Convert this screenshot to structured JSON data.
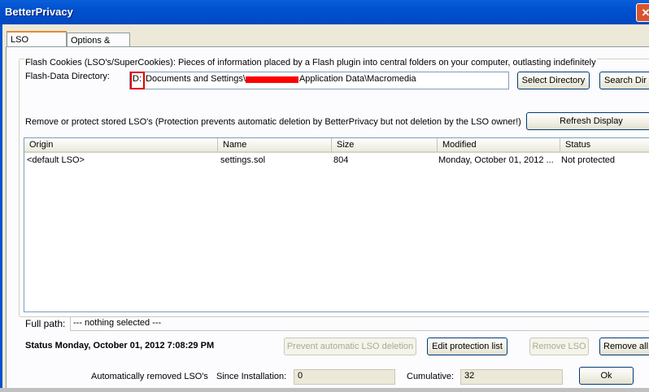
{
  "window": {
    "title": "BetterPrivacy",
    "close_glyph": "✕"
  },
  "tabs": [
    {
      "label": "LSO Manager"
    },
    {
      "label": "Options & Help"
    }
  ],
  "group": {
    "description": "Flash Cookies (LSO's/SuperCookies): Pieces of information placed by a Flash plugin into central folders on your computer, outlasting indefinitely",
    "directory_label": "Flash-Data Directory:",
    "directory_drive": "D:",
    "directory_path_prefix": "Documents and Settings\\",
    "directory_path_suffix": "Application Data\\Macromedia",
    "select_directory_button": "Select Directory",
    "search_button": "Search Dir"
  },
  "instruction": "Remove or protect stored LSO's (Protection prevents automatic deletion by BetterPrivacy but not deletion by the LSO owner!)",
  "refresh_button": "Refresh Display",
  "table": {
    "columns": [
      "Origin",
      "Name",
      "Size",
      "Modified",
      "Status"
    ],
    "rows": [
      {
        "origin": "<default LSO>",
        "name": "settings.sol",
        "size": "804",
        "modified": "Monday, October 01, 2012 ...",
        "status": "Not protected"
      }
    ]
  },
  "full_path": {
    "label": "Full path:",
    "value": "--- nothing selected ---"
  },
  "status_text": "Status Monday, October 01, 2012 7:08:29 PM",
  "actions": {
    "prevent_deletion": "Prevent automatic LSO deletion",
    "edit_protection": "Edit protection list",
    "remove_lso": "Remove LSO",
    "remove_all": "Remove all"
  },
  "footer": {
    "auto_removed_label": "Automatically removed LSO's",
    "since_install_label": "Since Installation:",
    "since_install_value": "0",
    "cumulative_label": "Cumulative:",
    "cumulative_value": "32",
    "ok_button": "Ok"
  }
}
